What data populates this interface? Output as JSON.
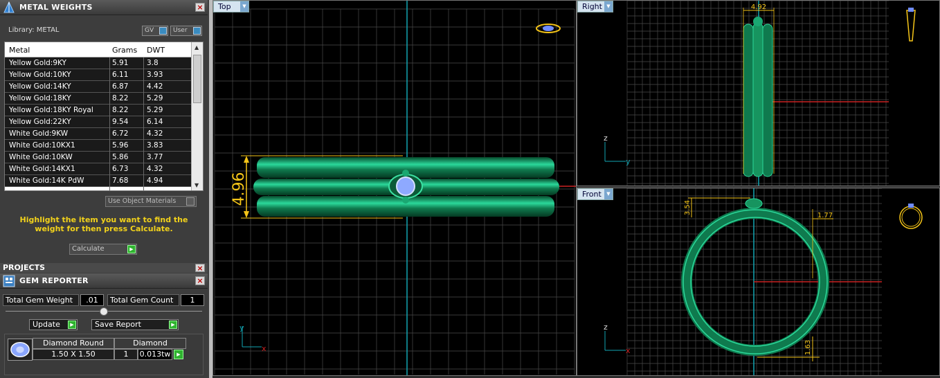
{
  "metal_weights": {
    "title": "METAL WEIGHTS",
    "library_label": "Library: METAL",
    "toggle_gv": "GV",
    "toggle_user": "User",
    "columns": [
      "Metal",
      "Grams",
      "DWT"
    ],
    "rows": [
      [
        "Yellow Gold:9KY",
        "5.91",
        "3.8"
      ],
      [
        "Yellow Gold:10KY",
        "6.11",
        "3.93"
      ],
      [
        "Yellow Gold:14KY",
        "6.87",
        "4.42"
      ],
      [
        "Yellow Gold:18KY",
        "8.22",
        "5.29"
      ],
      [
        "Yellow Gold:18KY Royal",
        "8.22",
        "5.29"
      ],
      [
        "Yellow Gold:22KY",
        "9.54",
        "6.14"
      ],
      [
        "White Gold:9KW",
        "6.72",
        "4.32"
      ],
      [
        "White Gold:10KX1",
        "5.96",
        "3.83"
      ],
      [
        "White Gold:10KW",
        "5.86",
        "3.77"
      ],
      [
        "White Gold:14KX1",
        "6.73",
        "4.32"
      ],
      [
        "White Gold:14K PdW",
        "7.68",
        "4.94"
      ]
    ],
    "use_object_materials": "Use Object Materials",
    "hint": "Highlight the item you want to find the weight for then press Calculate.",
    "calculate": "Calculate"
  },
  "projects": {
    "title": "PROJECTS"
  },
  "gem_reporter": {
    "title": "GEM REPORTER",
    "total_weight_label": "Total Gem Weight",
    "total_weight_value": ".01",
    "total_count_label": "Total Gem Count",
    "total_count_value": "1",
    "update": "Update",
    "save_report": "Save Report",
    "gem_shape": "Diamond Round",
    "gem_size": "1.50 X 1.50",
    "gem_type": "Diamond",
    "gem_qty": "1",
    "gem_weight": "0.013tw"
  },
  "viewports": {
    "top": {
      "label": "Top",
      "dimension": "4.96"
    },
    "right": {
      "label": "Right",
      "dimension": "4.92"
    },
    "front": {
      "label": "Front",
      "dim_a": "3.54",
      "dim_b": "1.77",
      "dim_c": "1.63"
    }
  },
  "colors": {
    "ring": "#0f7a4e",
    "grid": "#4a4a4a",
    "dim": "#f5c518",
    "axis_x": "#cc2222",
    "axis_y": "#12a6b3"
  }
}
